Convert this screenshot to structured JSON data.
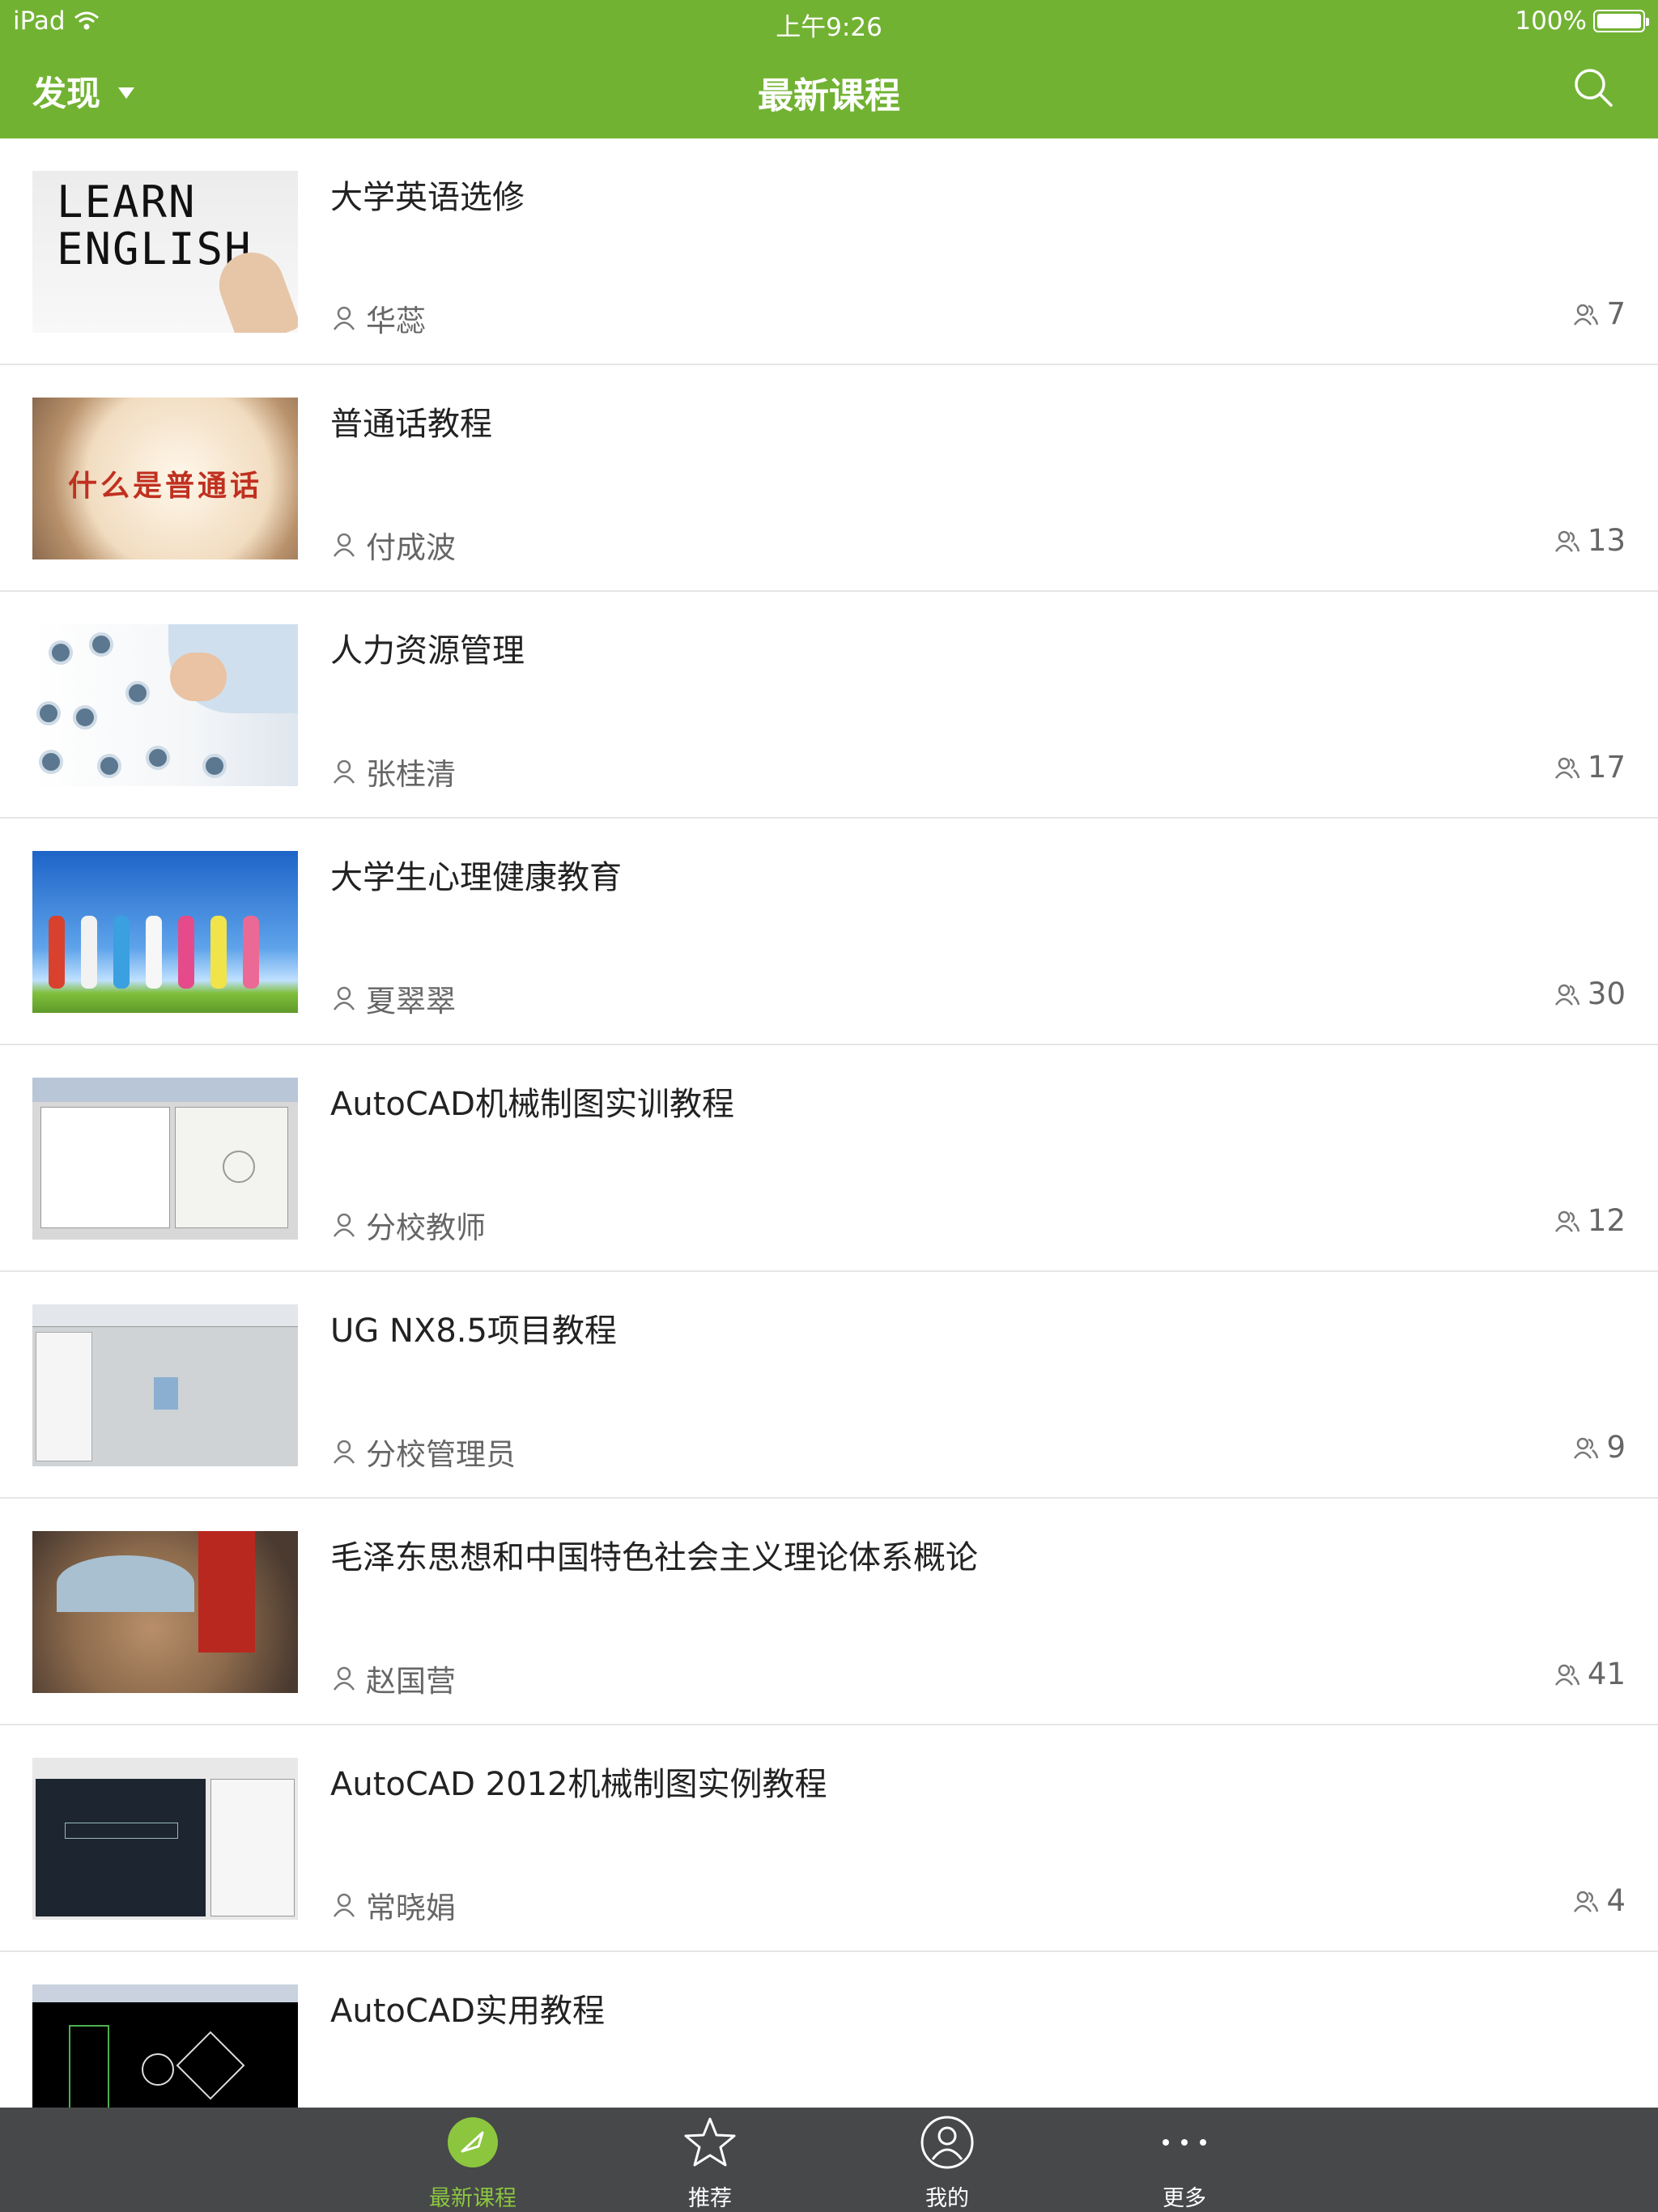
{
  "status": {
    "device": "iPad",
    "time": "上午9:26",
    "battery": "100%"
  },
  "nav": {
    "left_label": "发现",
    "title": "最新课程"
  },
  "courses": [
    {
      "title": "大学英语选修",
      "teacher": "华蕊",
      "count": "7",
      "thumb_text": "LEARN\nENGLISH"
    },
    {
      "title": "普通话教程",
      "teacher": "付成波",
      "count": "13",
      "thumb_text": "什么是普通话"
    },
    {
      "title": "人力资源管理",
      "teacher": "张桂清",
      "count": "17"
    },
    {
      "title": "大学生心理健康教育",
      "teacher": "夏翠翠",
      "count": "30"
    },
    {
      "title": "AutoCAD机械制图实训教程",
      "teacher": "分校教师",
      "count": "12"
    },
    {
      "title": "UG NX8.5项目教程",
      "teacher": "分校管理员",
      "count": "9"
    },
    {
      "title": "毛泽东思想和中国特色社会主义理论体系概论",
      "teacher": "赵国营",
      "count": "41"
    },
    {
      "title": "AutoCAD 2012机械制图实例教程",
      "teacher": "常晓娟",
      "count": "4"
    },
    {
      "title": "AutoCAD实用教程",
      "teacher": "",
      "count": ""
    }
  ],
  "tabs": [
    {
      "label": "最新课程",
      "icon": "compass-icon",
      "active": true
    },
    {
      "label": "推荐",
      "icon": "star-icon",
      "active": false
    },
    {
      "label": "我的",
      "icon": "user-circle-icon",
      "active": false
    },
    {
      "label": "更多",
      "icon": "more-dots-icon",
      "active": false
    }
  ],
  "colors": {
    "brand_green": "#72b233",
    "active_tab": "#8cc63f",
    "tabbar_bg": "#46484a"
  }
}
